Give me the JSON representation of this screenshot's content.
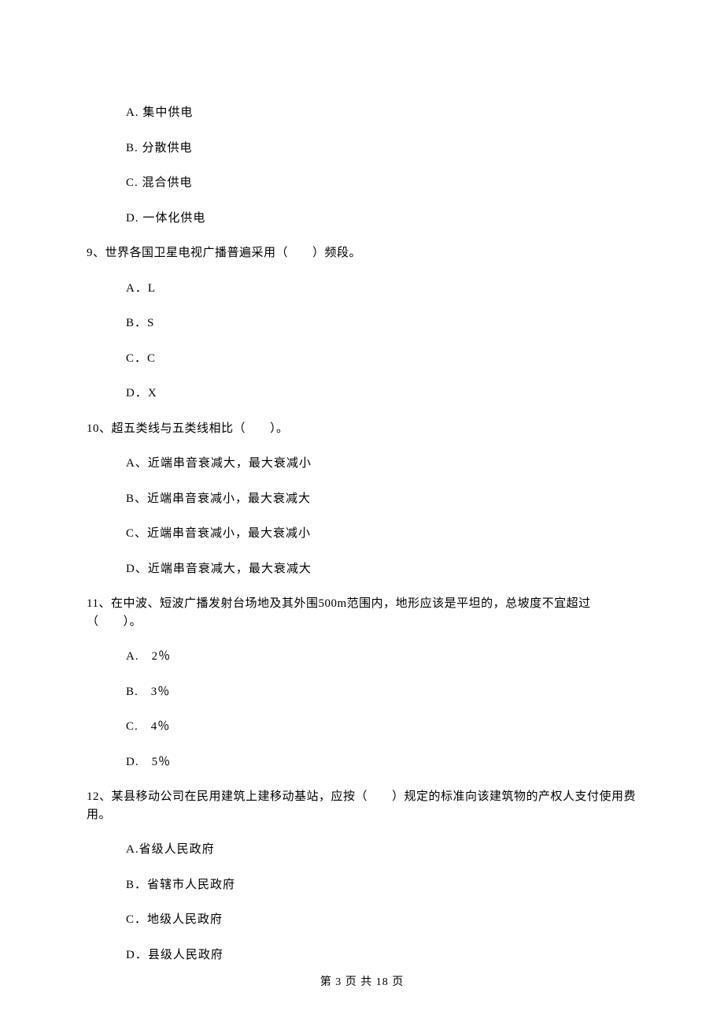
{
  "q8": {
    "options": {
      "a": "A. 集中供电",
      "b": "B. 分散供电",
      "c": "C. 混合供电",
      "d": "D. 一体化供电"
    }
  },
  "q9": {
    "stem": "9、世界各国卫星电视广播普遍采用（　　）频段。",
    "options": {
      "a": "A．L",
      "b": "B．S",
      "c": "C．C",
      "d": "D．X"
    }
  },
  "q10": {
    "stem": "10、超五类线与五类线相比（　　）。",
    "options": {
      "a": "A、近端串音衰减大，最大衰减小",
      "b": "B、近端串音衰减小，最大衰减大",
      "c": "C、近端串音衰减小，最大衰减小",
      "d": "D、近端串音衰减大，最大衰减大"
    }
  },
  "q11": {
    "stem": "11、在中波、短波广播发射台场地及其外围500m范围内，地形应该是平坦的，总坡度不宜超过（　　）。",
    "options": {
      "a": "A.　2％",
      "b": "B.　3％",
      "c": "C.　4％",
      "d": "D.　5％"
    }
  },
  "q12": {
    "stem": "12、某县移动公司在民用建筑上建移动基站，应按（　　）规定的标准向该建筑物的产权人支付使用费用。",
    "options": {
      "a": "A.省级人民政府",
      "b": "B．省辖市人民政府",
      "c": "C．地级人民政府",
      "d": "D．县级人民政府"
    }
  },
  "footer": "第 3 页 共 18 页"
}
